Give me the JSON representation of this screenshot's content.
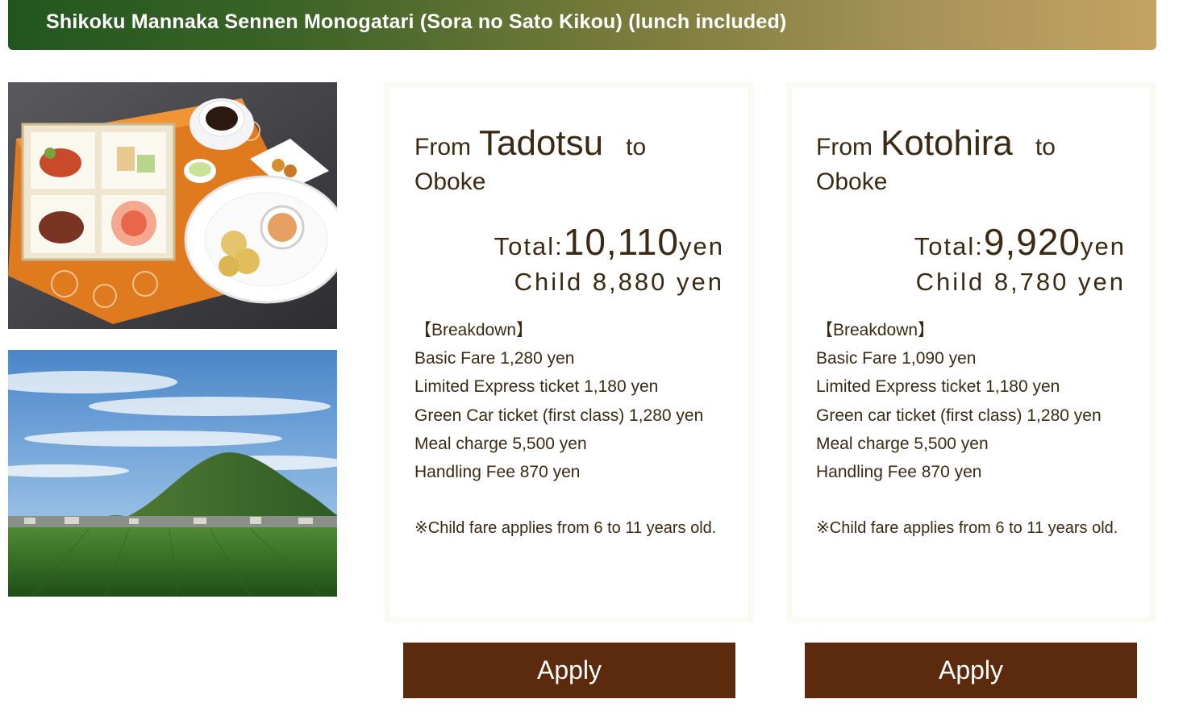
{
  "header": {
    "title": "Shikoku Mannaka Sennen Monogatari (Sora no Sato Kikou) (lunch included)"
  },
  "plans": [
    {
      "from_label": "From",
      "from_station": "Tadotsu",
      "to_label": "to",
      "to_station": "Oboke",
      "total_label": "Total:",
      "total_amount": "10,110",
      "total_unit": "yen",
      "child_text": "Child 8,880 yen",
      "breakdown_title": "【Breakdown】",
      "breakdown": [
        "Basic Fare 1,280 yen",
        "Limited Express ticket 1,180 yen",
        "Green Car ticket (first class) 1,280 yen",
        "Meal charge 5,500 yen",
        "Handling Fee 870 yen"
      ],
      "note": "※Child fare applies from 6 to 11 years old.",
      "apply_label": "Apply"
    },
    {
      "from_label": "From",
      "from_station": "Kotohira",
      "to_label": "to",
      "to_station": "Oboke",
      "total_label": "Total:",
      "total_amount": "9,920",
      "total_unit": "yen",
      "child_text": "Child 8,780 yen",
      "breakdown_title": "【Breakdown】",
      "breakdown": [
        "Basic Fare 1,090 yen",
        "Limited Express ticket 1,180 yen",
        "Green car ticket (first class) 1,280 yen",
        "Meal charge 5,500 yen",
        "Handling Fee 870 yen"
      ],
      "note": "※Child fare applies from 6 to 11 years old.",
      "apply_label": "Apply"
    }
  ],
  "colors": {
    "header_start": "#22561f",
    "header_end": "#c4a363",
    "button": "#5c2a0c",
    "text": "#3a2a14"
  }
}
